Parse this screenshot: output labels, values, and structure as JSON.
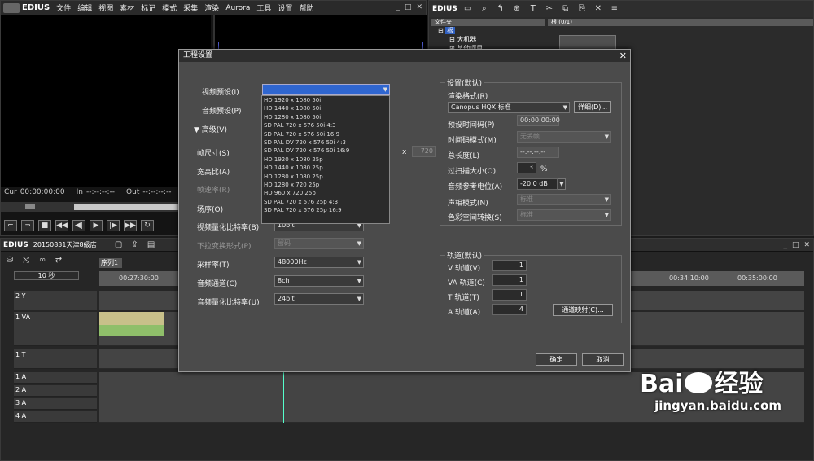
{
  "app": {
    "brand": "EDIUS",
    "menu": [
      "文件",
      "编辑",
      "视图",
      "素材",
      "标记",
      "模式",
      "采集",
      "渲染",
      "Aurora",
      "工具",
      "设置",
      "帮助"
    ]
  },
  "player": {
    "cur_label": "Cur",
    "cur_value": "00:00:00:00",
    "in_label": "In",
    "in_value": "--:--:--:--",
    "out_label": "Out",
    "out_value": "--:--:--:--"
  },
  "bin": {
    "brand": "EDIUS",
    "panel_title": "文件夹",
    "root": "根",
    "folder_1": "大机器",
    "folder_2": "某他项目",
    "content_title": "根 (0/1)"
  },
  "timeline": {
    "brand": "EDIUS",
    "project": "20150831天津8級店",
    "sequence_tab": "序列1",
    "zoom": "10 秒",
    "times": [
      "00:27:30:00",
      "00:34:10:00",
      "00:35:00:00"
    ],
    "tracks": [
      "2 Y",
      "1 VA",
      "1 T",
      "1 A",
      "2 A",
      "3 A",
      "4 A"
    ]
  },
  "dialog": {
    "title": "工程设置",
    "video_preset_label": "视频预设(I)",
    "audio_preset_label": "音频预设(P)",
    "advanced_label": "高级(V)",
    "frame_size_label": "帧尺寸(S)",
    "aspect_label": "宽高比(A)",
    "frame_rate_label": "帧速率(R)",
    "field_order_label": "场序(O)",
    "video_quant_label": "视频量化比特率(B)",
    "video_quant_value": "10bit",
    "pulldown_label": "下拉变换形式(P)",
    "pulldown_value": "留码",
    "sample_rate_label": "采样率(T)",
    "sample_rate_value": "48000Hz",
    "audio_channels_label": "音频通道(C)",
    "audio_channels_value": "8ch",
    "audio_quant_label": "音频量化比特率(U)",
    "audio_quant_value": "24bit",
    "height_value": "720",
    "x_mark": "x",
    "settings_group": "设置(默认)",
    "render_format_label": "渲染格式(R)",
    "render_format_value": "Canopus HQX 标准",
    "detail_button": "详细(D)...",
    "preset_tc_label": "预设时间码(P)",
    "preset_tc_value": "00:00:00:00",
    "tc_mode_label": "时间码模式(M)",
    "tc_mode_value": "无丢帧",
    "total_length_label": "总长度(L)",
    "total_length_value": "--:--:--:--",
    "overscan_label": "过扫描大小(O)",
    "overscan_value": "3",
    "overscan_unit": "%",
    "audio_ref_label": "音频参考电位(A)",
    "audio_ref_value": "-20.0 dB",
    "pan_label": "声相模式(N)",
    "pan_value": "标准",
    "color_label": "色彩空间转换(S)",
    "color_value": "标准",
    "tracks_group": "轨道(默认)",
    "v_track_label": "V 轨道(V)",
    "v_track_value": "1",
    "va_track_label": "VA 轨道(C)",
    "va_track_value": "1",
    "t_track_label": "T 轨道(T)",
    "t_track_value": "1",
    "a_track_label": "A 轨道(A)",
    "a_track_value": "4",
    "channel_map_button": "通道映射(C)...",
    "ok_button": "确定",
    "cancel_button": "取消",
    "close_glyph": "✕"
  },
  "dropdown": {
    "options": [
      "HD 1920 x 1080 50i",
      "HD 1440 x 1080 50i",
      "HD 1280 x 1080 50i",
      "SD PAL 720 x 576 50i 4:3",
      "SD PAL 720 x 576 50i 16:9",
      "SD PAL DV 720 x 576 50i 4:3",
      "SD PAL DV 720 x 576 50i 16:9",
      "HD 1920 x 1080 25p",
      "HD 1440 x 1080 25p",
      "HD 1280 x 1080 25p",
      "HD 1280 x 720 25p",
      "HD 960 x 720 25p",
      "SD PAL 720 x 576 25p 4:3",
      "SD PAL 720 x 576 25p 16:9"
    ]
  },
  "watermark": {
    "brand": "Bai",
    "brand2": "经验",
    "url": "jingyan.baidu.com"
  }
}
